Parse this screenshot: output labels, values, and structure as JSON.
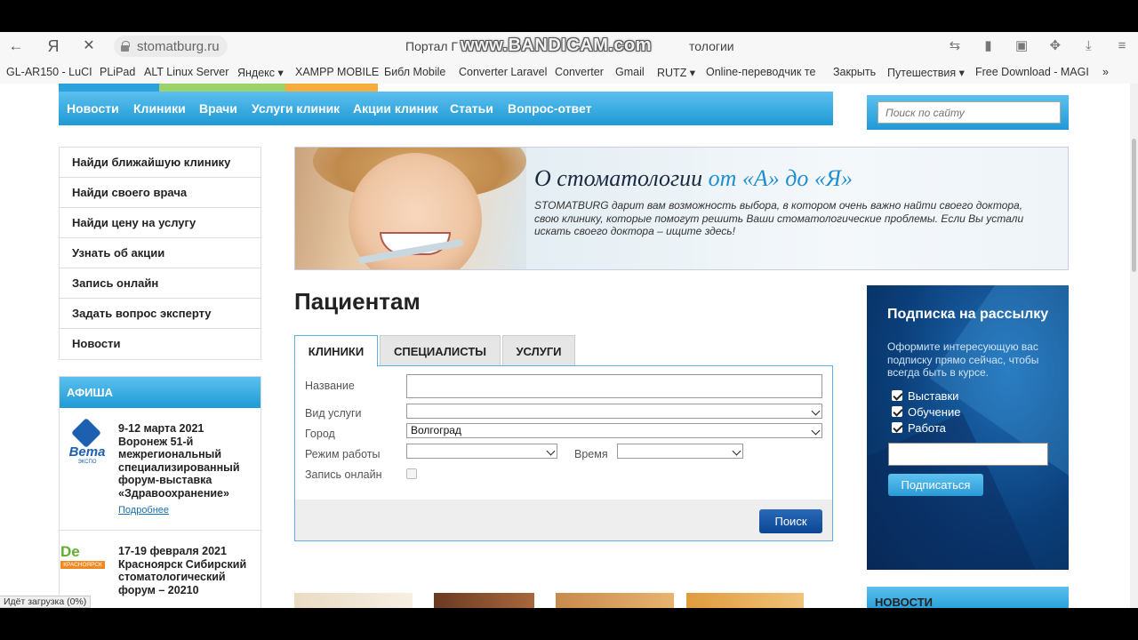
{
  "browser": {
    "url": "stomatburg.ru",
    "tab_title": "Портал Г",
    "tab_title_end": "тологии",
    "watermark": "www.BANDICAM.com",
    "status": "Идёт загрузка (0%)",
    "bookmarks": [
      "GL-AR150 - LuCI",
      "PLiPad",
      "ALT Linux Server",
      "Яндекс ▾",
      "XAMPP MOBILE",
      "Библ Mobile",
      "Converter Laravel",
      "Converter",
      "Gmail",
      "RUTZ ▾",
      "Online-переводчик тe",
      "Закрыть",
      "Путешествия ▾",
      "Free Download - MAGI",
      "»"
    ]
  },
  "nav": {
    "items": [
      "Новости",
      "Клиники",
      "Врачи",
      "Услуги клиник",
      "Акции клиник",
      "Статьи",
      "Вопрос-ответ"
    ]
  },
  "search": {
    "placeholder": "Поиск по сайту"
  },
  "side_menu": {
    "items": [
      "Найди ближайшую клинику",
      "Найди своего врача",
      "Найди цену на услугу",
      "Узнать об акции",
      "Запись онлайн",
      "Задать вопрос эксперту",
      "Новости"
    ]
  },
  "afisha": {
    "title": "АФИША",
    "events": [
      {
        "logo": "Вета",
        "logo_sub": "ЭКСПО",
        "text": "9-12 марта 2021 Воронеж 51-й межрегиональный специализированный форум-выставка «Здравоохранение»",
        "more": "Подробнее"
      },
      {
        "logo": "De",
        "logo_sub": "КРАСНОЯРСК",
        "text": "17-19 февраля 2021 Красноярск Сибирский стоматологический форум – 20210"
      }
    ]
  },
  "banner": {
    "title_main": "О стоматологии ",
    "title_accent": "от «А» до «Я»",
    "text": "STOMATBURG дарит вам возможность выбора, в котором очень важно найти своего доктора, свою клинику, которые помогут решить Ваши стоматологические проблемы. Если Вы устали искать своего доктора – ищите здесь!"
  },
  "patients": {
    "heading": "Пациентам",
    "tabs": [
      "КЛИНИКИ",
      "СПЕЦИАЛИСТЫ",
      "УСЛУГИ"
    ],
    "form": {
      "name_label": "Название",
      "service_label": "Вид услуги",
      "city_label": "Город",
      "city_value": "Волгоград",
      "mode_label": "Режим работы",
      "time_label": "Время",
      "online_label": "Запись онлайн",
      "submit": "Поиск"
    }
  },
  "subscribe": {
    "title": "Подписка на рассылку",
    "text": "Оформите интересующую вас подписку прямо сейчас, чтобы всегда быть в курсе.",
    "options": [
      "Выставки",
      "Обучение",
      "Работа"
    ],
    "button": "Подписаться"
  },
  "news": {
    "title": "НОВОСТИ"
  },
  "colors": {
    "accent": "#1f9ad6",
    "button_dark": "#0b4594",
    "subscribe_bg": "#0b3f7a"
  }
}
